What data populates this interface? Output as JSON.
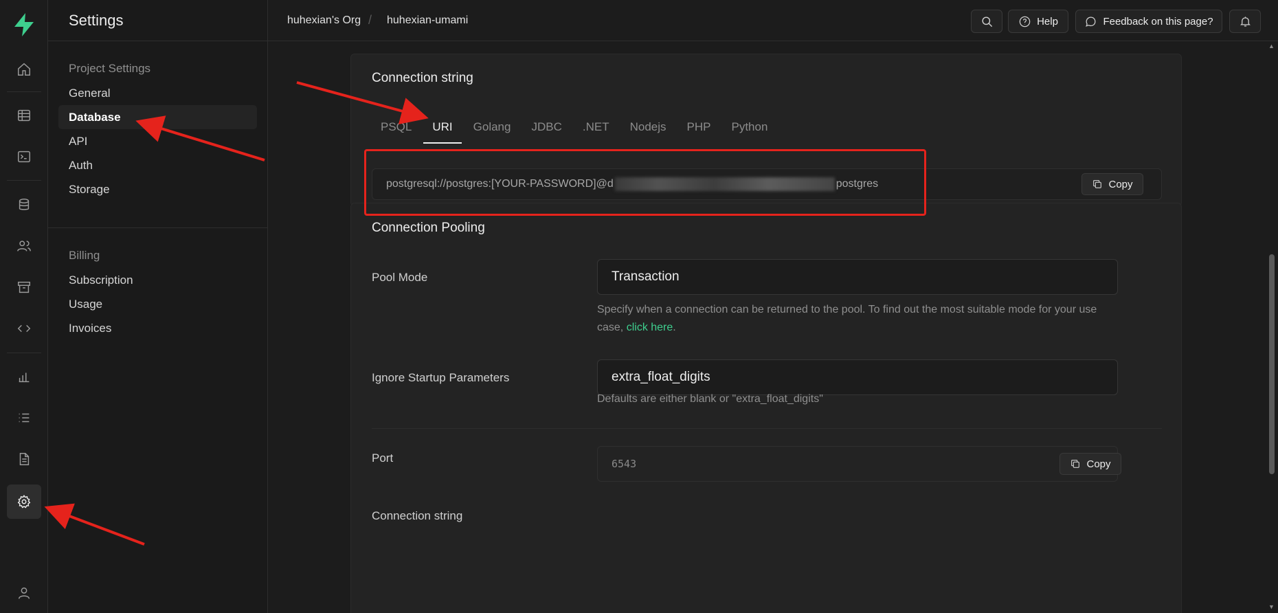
{
  "app": {
    "brand_color": "#3ecf8e",
    "logo_icon": "supabase-logo-icon"
  },
  "rail": {
    "icons": [
      "home-icon",
      "table-editor-icon",
      "sql-editor-icon",
      "database-icon",
      "auth-users-icon",
      "storage-icon",
      "edge-functions-icon",
      "reports-icon",
      "logs-icon",
      "api-docs-icon",
      "settings-icon",
      "account-icon"
    ],
    "active": "settings-icon"
  },
  "sidebar": {
    "title": "Settings",
    "project_section": {
      "title": "Project Settings",
      "items": [
        "General",
        "Database",
        "API",
        "Auth",
        "Storage"
      ],
      "active": "Database"
    },
    "billing_section": {
      "title": "Billing",
      "items": [
        "Subscription",
        "Usage",
        "Invoices"
      ]
    }
  },
  "topbar": {
    "breadcrumb": [
      "huhexian's Org",
      "huhexian-umami"
    ],
    "search_icon": "search-icon",
    "help_label": "Help",
    "feedback_label": "Feedback on this page?",
    "notifications_icon": "bell-icon"
  },
  "connection_string": {
    "title": "Connection string",
    "tabs": [
      "PSQL",
      "URI",
      "Golang",
      "JDBC",
      ".NET",
      "Nodejs",
      "PHP",
      "Python"
    ],
    "active_tab": "URI",
    "value_prefix": "postgresql://postgres:[YOUR-PASSWORD]@d",
    "value_suffix": "postgres",
    "copy_label": "Copy"
  },
  "connection_pooling": {
    "title": "Connection Pooling",
    "pool_mode": {
      "label": "Pool Mode",
      "value": "Transaction",
      "help": "Specify when a connection can be returned to the pool. To find out the most suitable mode for your use case,",
      "help_link": "click here",
      "help_end": "."
    },
    "ignore_startup": {
      "label": "Ignore Startup Parameters",
      "value": "extra_float_digits",
      "help": "Defaults are either blank or \"extra_float_digits\""
    },
    "port": {
      "label": "Port",
      "value": "6543",
      "copy_label": "Copy"
    },
    "connection_string_label": "Connection string"
  },
  "annotation_color": "#e5231c"
}
